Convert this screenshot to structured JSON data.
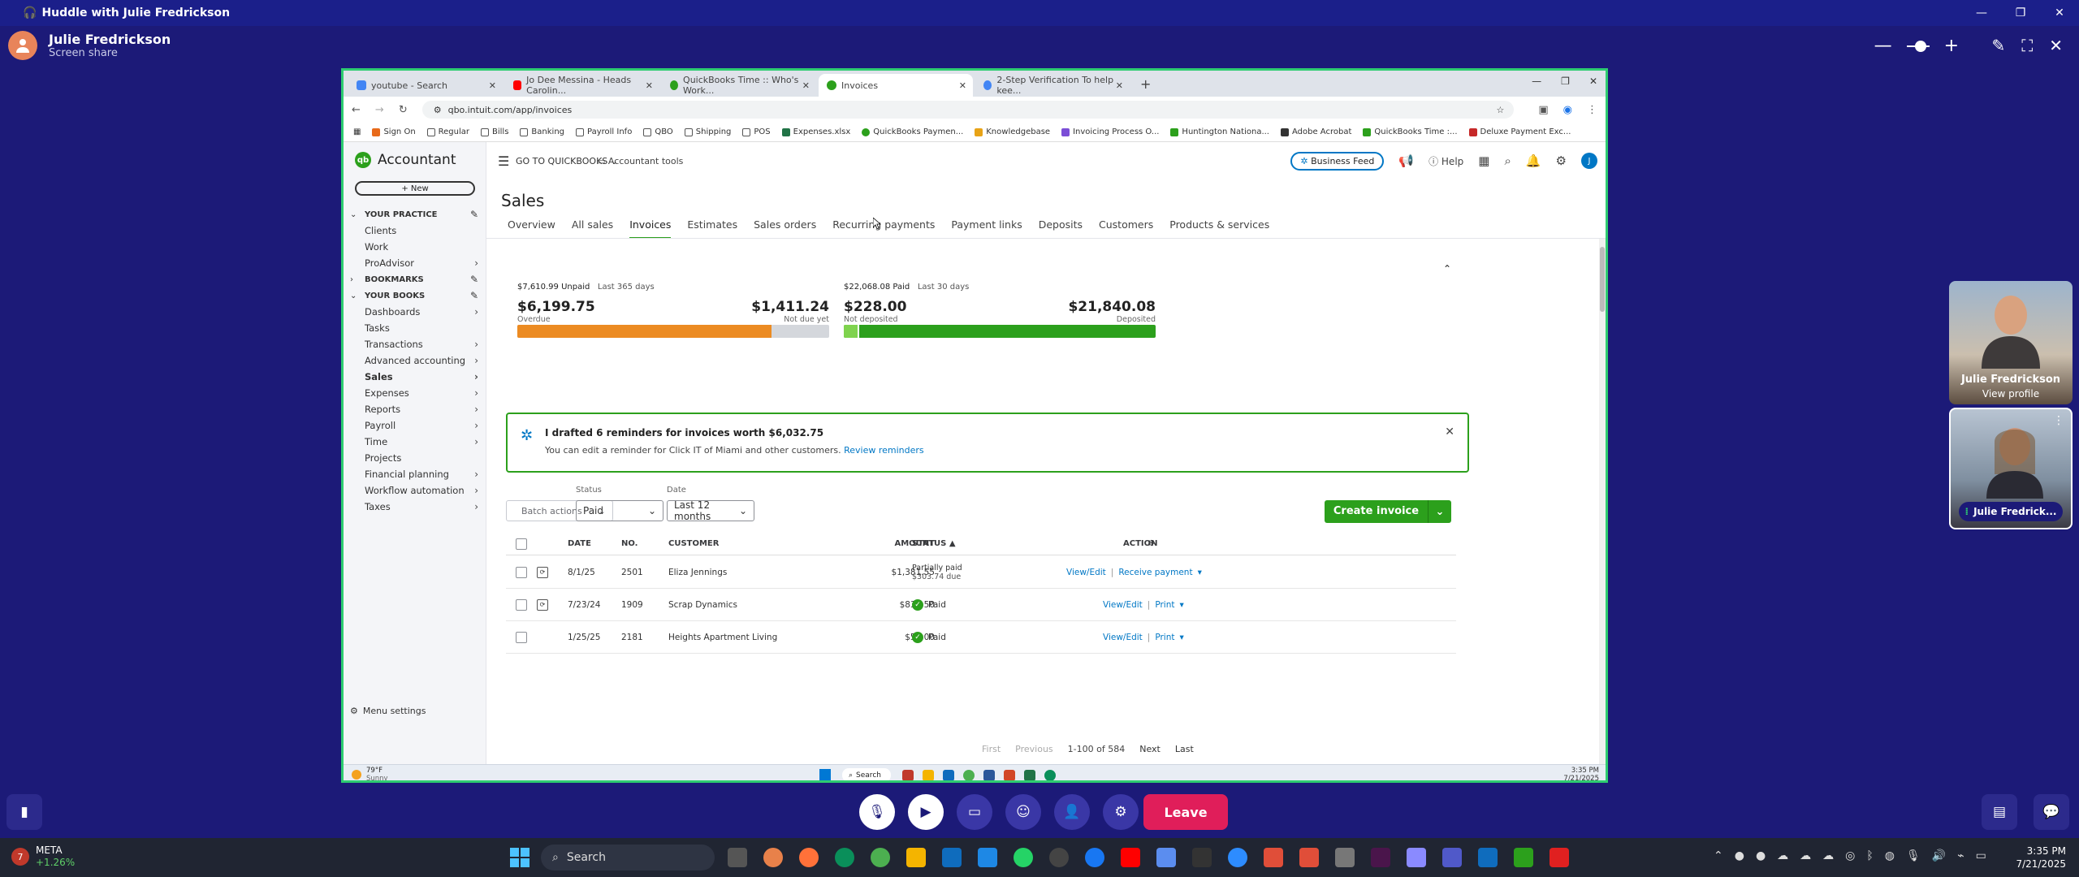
{
  "huddle": {
    "window_title": "Huddle with Julie Fredrickson",
    "presenter_name": "Julie Fredrickson",
    "presenter_sub": "Screen share",
    "leave_label": "Leave",
    "participants": [
      {
        "name": "Julie Fredrickson",
        "sub": "View profile"
      },
      {
        "name": "Julie Fredrick..."
      }
    ]
  },
  "browser": {
    "tabs": [
      {
        "title": "youtube - Search",
        "color": "#4285f4"
      },
      {
        "title": "Jo Dee Messina - Heads Carolin...",
        "color": "#ff0000"
      },
      {
        "title": "QuickBooks Time :: Who's Work...",
        "color": "#2ca01c"
      },
      {
        "title": "Invoices",
        "color": "#2ca01c",
        "active": true
      },
      {
        "title": "2-Step Verification To help kee...",
        "color": "#4285f4"
      }
    ],
    "url": "qbo.intuit.com/app/invoices",
    "bookmarks": [
      {
        "label": "Sign On",
        "color": "#e86a1a"
      },
      {
        "label": "Regular",
        "color": "#f4b400"
      },
      {
        "label": "Bills",
        "color": "#f4b400"
      },
      {
        "label": "Banking",
        "color": "#f4b400"
      },
      {
        "label": "Payroll Info",
        "color": "#f4b400"
      },
      {
        "label": "QBO",
        "color": "#f4b400"
      },
      {
        "label": "Shipping",
        "color": "#f4b400"
      },
      {
        "label": "POS",
        "color": "#f4b400"
      },
      {
        "label": "Expenses.xlsx",
        "color": "#217346"
      },
      {
        "label": "QuickBooks Paymen...",
        "color": "#2ca01c"
      },
      {
        "label": "Knowledgebase",
        "color": "#e8a317"
      },
      {
        "label": "Invoicing Process O...",
        "color": "#7b4ed6"
      },
      {
        "label": "Huntington Nationa...",
        "color": "#2ca01c"
      },
      {
        "label": "Adobe Acrobat",
        "color": "#333333"
      },
      {
        "label": "QuickBooks Time :...",
        "color": "#2ca01c"
      },
      {
        "label": "Deluxe Payment Exc...",
        "color": "#c62828"
      }
    ]
  },
  "sidebar": {
    "app_name": "Accountant",
    "new_label": "+ New",
    "sections": {
      "practice": "YOUR PRACTICE",
      "bookmarks": "BOOKMARKS",
      "books": "YOUR BOOKS"
    },
    "practice_items": [
      "Clients",
      "Work",
      "ProAdvisor"
    ],
    "book_items": [
      "Dashboards",
      "Tasks",
      "Transactions",
      "Advanced accounting",
      "Sales",
      "Expenses",
      "Reports",
      "Payroll",
      "Time",
      "Projects",
      "Financial planning",
      "Workflow automation",
      "Taxes"
    ],
    "menu_settings": "Menu settings"
  },
  "topbar": {
    "goto": "GO TO QUICKBOOKS",
    "accountant_tools": "Accountant tools",
    "business_feed": "Business Feed",
    "help": "Help",
    "avatar_initial": "J"
  },
  "page": {
    "title": "Sales",
    "subnav": [
      "Overview",
      "All sales",
      "Invoices",
      "Estimates",
      "Sales orders",
      "Recurring payments",
      "Payment links",
      "Deposits",
      "Customers",
      "Products & services"
    ],
    "active_subnav": "Invoices"
  },
  "money_bar": {
    "unpaid_label": "$7,610.99 Unpaid",
    "unpaid_period": "Last 365 days",
    "overdue_amount": "$6,199.75",
    "overdue_label": "Overdue",
    "not_due_amount": "$1,411.24",
    "not_due_label": "Not due yet",
    "overdue_fraction": 0.815,
    "paid_label": "$22,068.08 Paid",
    "paid_period": "Last 30 days",
    "not_deposited_amount": "$228.00",
    "not_deposited_label": "Not deposited",
    "deposited_amount": "$21,840.08",
    "deposited_label": "Deposited",
    "not_deposited_fraction": 0.05,
    "colors": {
      "overdue": "#ec8b22",
      "not_due": "#d4d7dc",
      "deposited": "#2ca01c",
      "not_deposited": "#7fd34e"
    }
  },
  "reminder": {
    "title": "I drafted 6 reminders for invoices worth $6,032.75",
    "body": "You can edit a reminder for Click IT of Miami and other customers.",
    "link": "Review reminders"
  },
  "filters": {
    "batch_actions": "Batch actions",
    "status_label": "Status",
    "status_value": "Paid",
    "date_label": "Date",
    "date_value": "Last 12 months",
    "create_invoice": "Create invoice"
  },
  "table": {
    "headers": {
      "date": "DATE",
      "no": "NO.",
      "customer": "CUSTOMER",
      "amount": "AMOUNT",
      "status": "STATUS ▲",
      "action": "ACTION"
    },
    "rows": [
      {
        "date": "8/1/25",
        "no": "2501",
        "customer": "Eliza Jennings",
        "amount": "$1,381.55",
        "status": "Partially paid",
        "status_sub": "$303.74 due",
        "paid": false,
        "action": "View/Edit",
        "action2": "Receive payment"
      },
      {
        "date": "7/23/24",
        "no": "1909",
        "customer": "Scrap Dynamics",
        "amount": "$833.50",
        "status": "Paid",
        "status_sub": "",
        "paid": true,
        "action": "View/Edit",
        "action2": "Print"
      },
      {
        "date": "1/25/25",
        "no": "2181",
        "customer": "Heights Apartment Living",
        "amount": "$57.00",
        "status": "Paid",
        "status_sub": "",
        "paid": true,
        "action": "View/Edit",
        "action2": "Print"
      }
    ],
    "pager": {
      "first": "First",
      "previous": "Previous",
      "range": "1-100 of 584",
      "next": "Next",
      "last": "Last"
    }
  },
  "shared_taskbar": {
    "weather_temp": "79°F",
    "weather_cond": "Sunny",
    "search": "Search",
    "time": "3:35 PM",
    "date": "7/21/2025"
  },
  "win_taskbar": {
    "stock_name": "META",
    "stock_change": "+1.26%",
    "search": "Search",
    "time": "3:35 PM",
    "date": "7/21/2025"
  }
}
